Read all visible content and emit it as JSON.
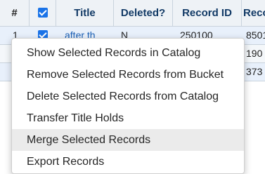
{
  "grid": {
    "headers": {
      "number": "#",
      "title": "Title",
      "deleted": "Deleted?",
      "record_id": "Record ID",
      "next_col": "Recor"
    },
    "rows": [
      {
        "num": "1",
        "title": "after th",
        "deleted": "N",
        "record_id": "250100",
        "next": "8501"
      },
      {
        "num": "",
        "title": "",
        "deleted": "",
        "record_id": "",
        "next": "190"
      },
      {
        "num": "",
        "title": "",
        "deleted": "",
        "record_id": "",
        "next": "373"
      }
    ]
  },
  "menu": {
    "items": [
      {
        "label": "Show Selected Records in Catalog"
      },
      {
        "label": "Remove Selected Records from Bucket"
      },
      {
        "label": "Delete Selected Records from Catalog"
      },
      {
        "label": "Transfer Title Holds"
      },
      {
        "label": "Merge Selected Records",
        "highlighted": true
      },
      {
        "label": "Export Records"
      }
    ]
  }
}
